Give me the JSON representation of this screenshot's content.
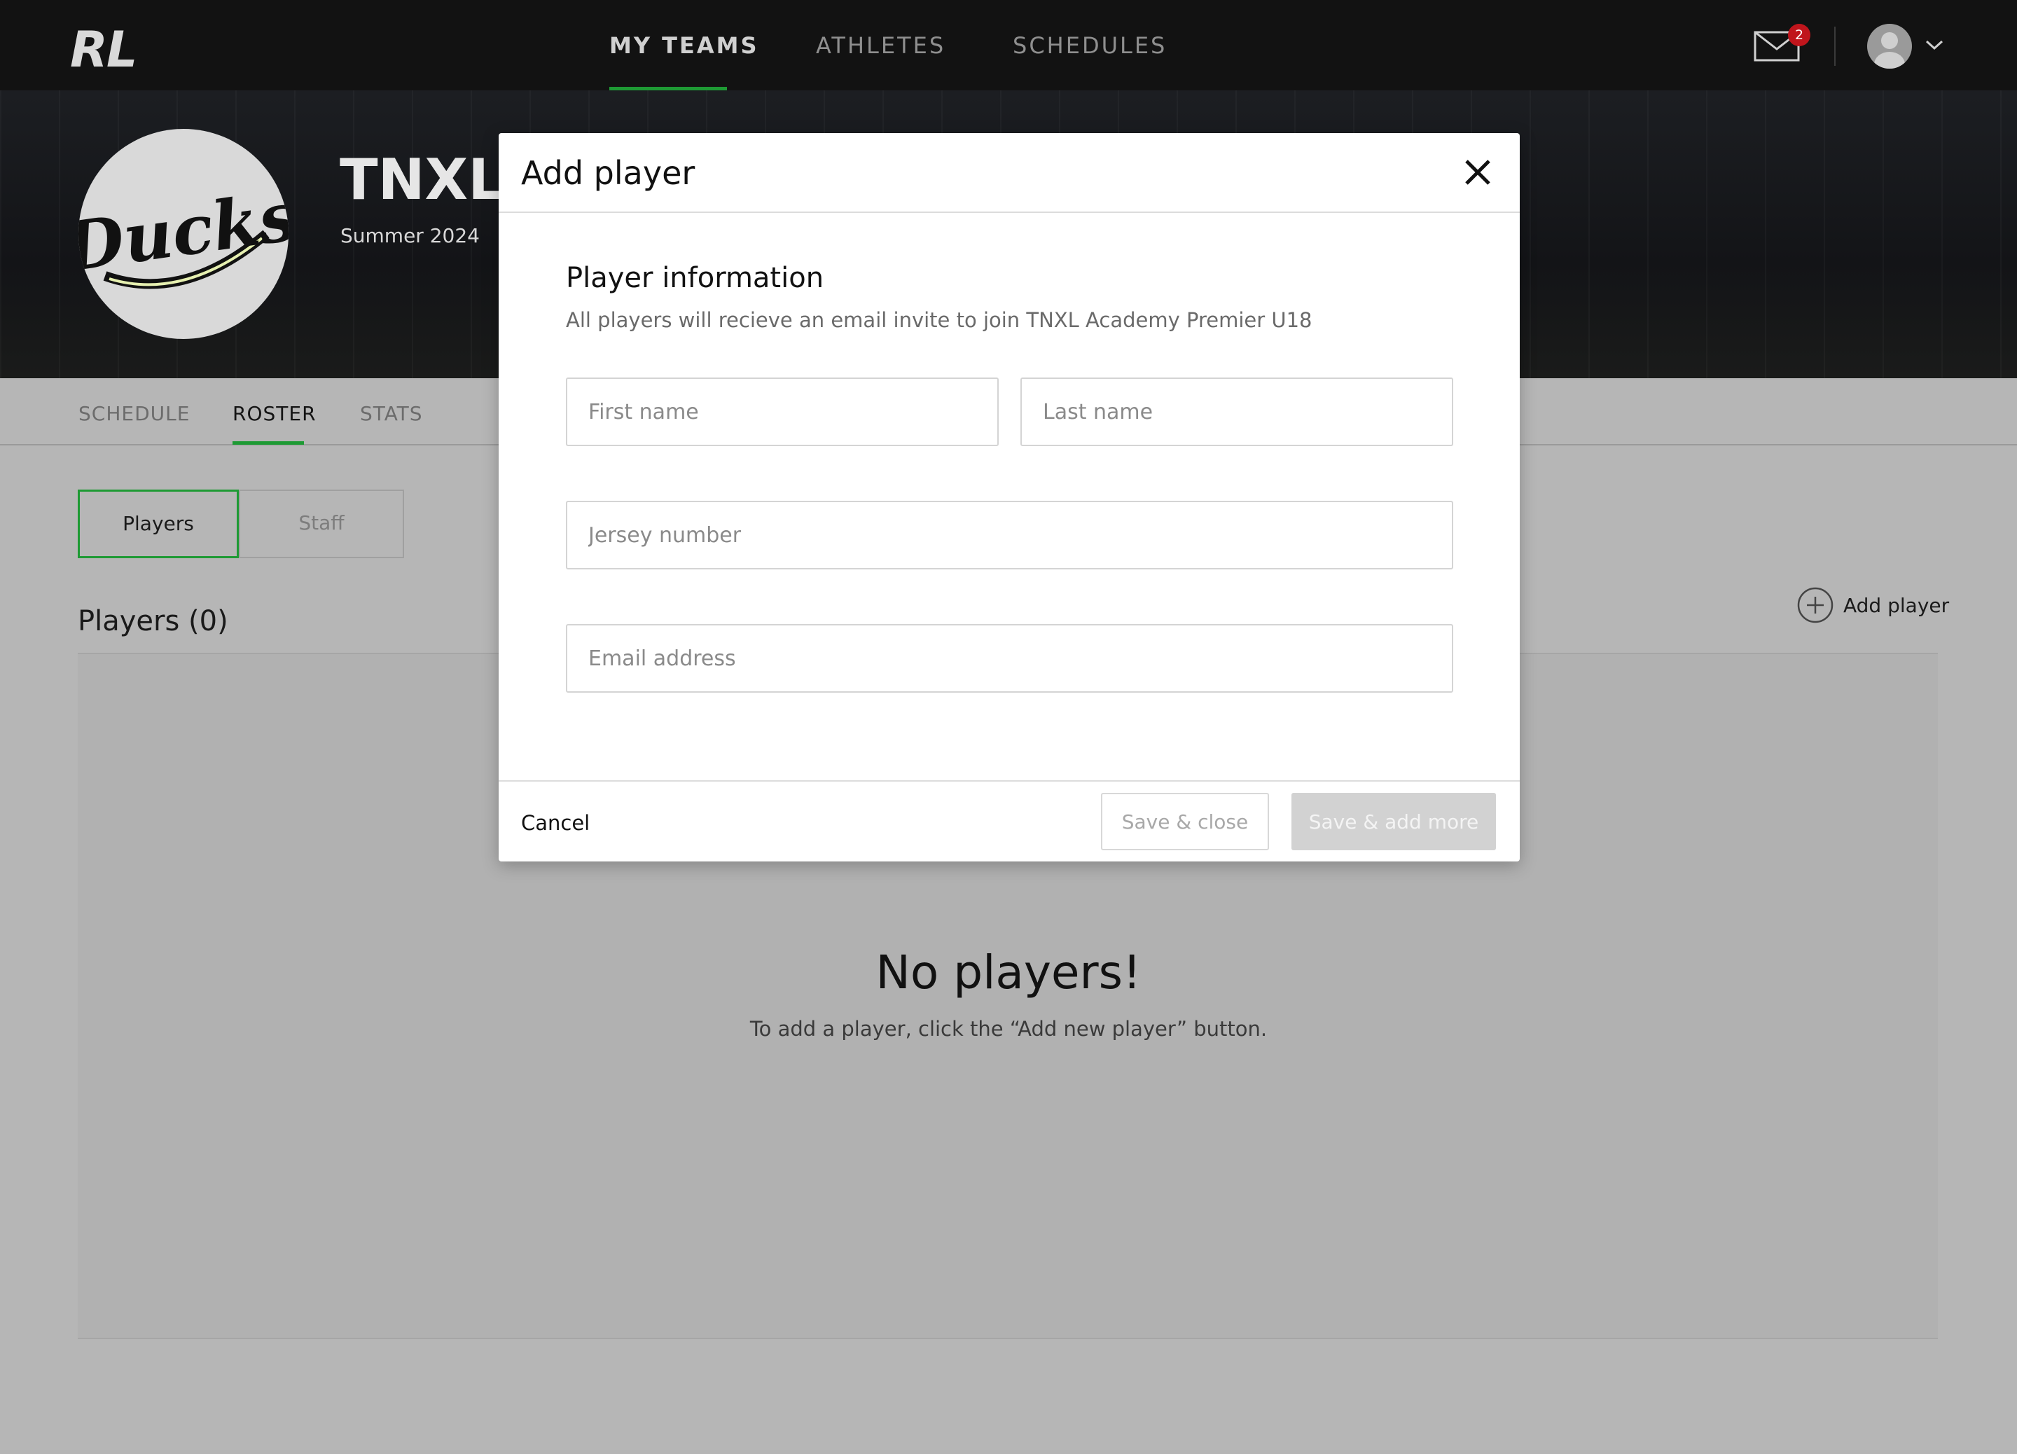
{
  "app": {
    "logo_text": "RL"
  },
  "nav": {
    "items": [
      {
        "label": "MY TEAMS",
        "active": true
      },
      {
        "label": "ATHLETES",
        "active": false
      },
      {
        "label": "SCHEDULES",
        "active": false
      }
    ],
    "mail_badge": "2",
    "icons": {
      "mail": "mail-icon",
      "avatar": "user-avatar-icon",
      "menu": "chevron-down-icon"
    },
    "accent_color": "#1e9a34"
  },
  "team": {
    "title": "TNXL",
    "season": "Summer 2024",
    "badge_text": "Ducks"
  },
  "tabs": [
    {
      "label": "SCHEDULE",
      "active": false
    },
    {
      "label": "ROSTER",
      "active": true
    },
    {
      "label": "STATS",
      "active": false
    }
  ],
  "roster": {
    "toggle": {
      "players": "Players",
      "staff": "Staff",
      "selected": "Players"
    },
    "heading": "Players (0)",
    "add_player": "Add player",
    "empty_title": "No players!",
    "empty_text": "To add a player, click the “Add new player” button."
  },
  "modal": {
    "title": "Add player",
    "section_title": "Player information",
    "section_sub": "All players will recieve an email invite to join TNXL Academy Premier U18",
    "fields": {
      "first_name": {
        "value": "",
        "placeholder": "First name"
      },
      "last_name": {
        "value": "",
        "placeholder": "Last name"
      },
      "jersey": {
        "value": "",
        "placeholder": "Jersey number"
      },
      "email": {
        "value": "",
        "placeholder": "Email address"
      }
    },
    "cancel": "Cancel",
    "save_close": "Save & close",
    "save_more": "Save & add more"
  }
}
